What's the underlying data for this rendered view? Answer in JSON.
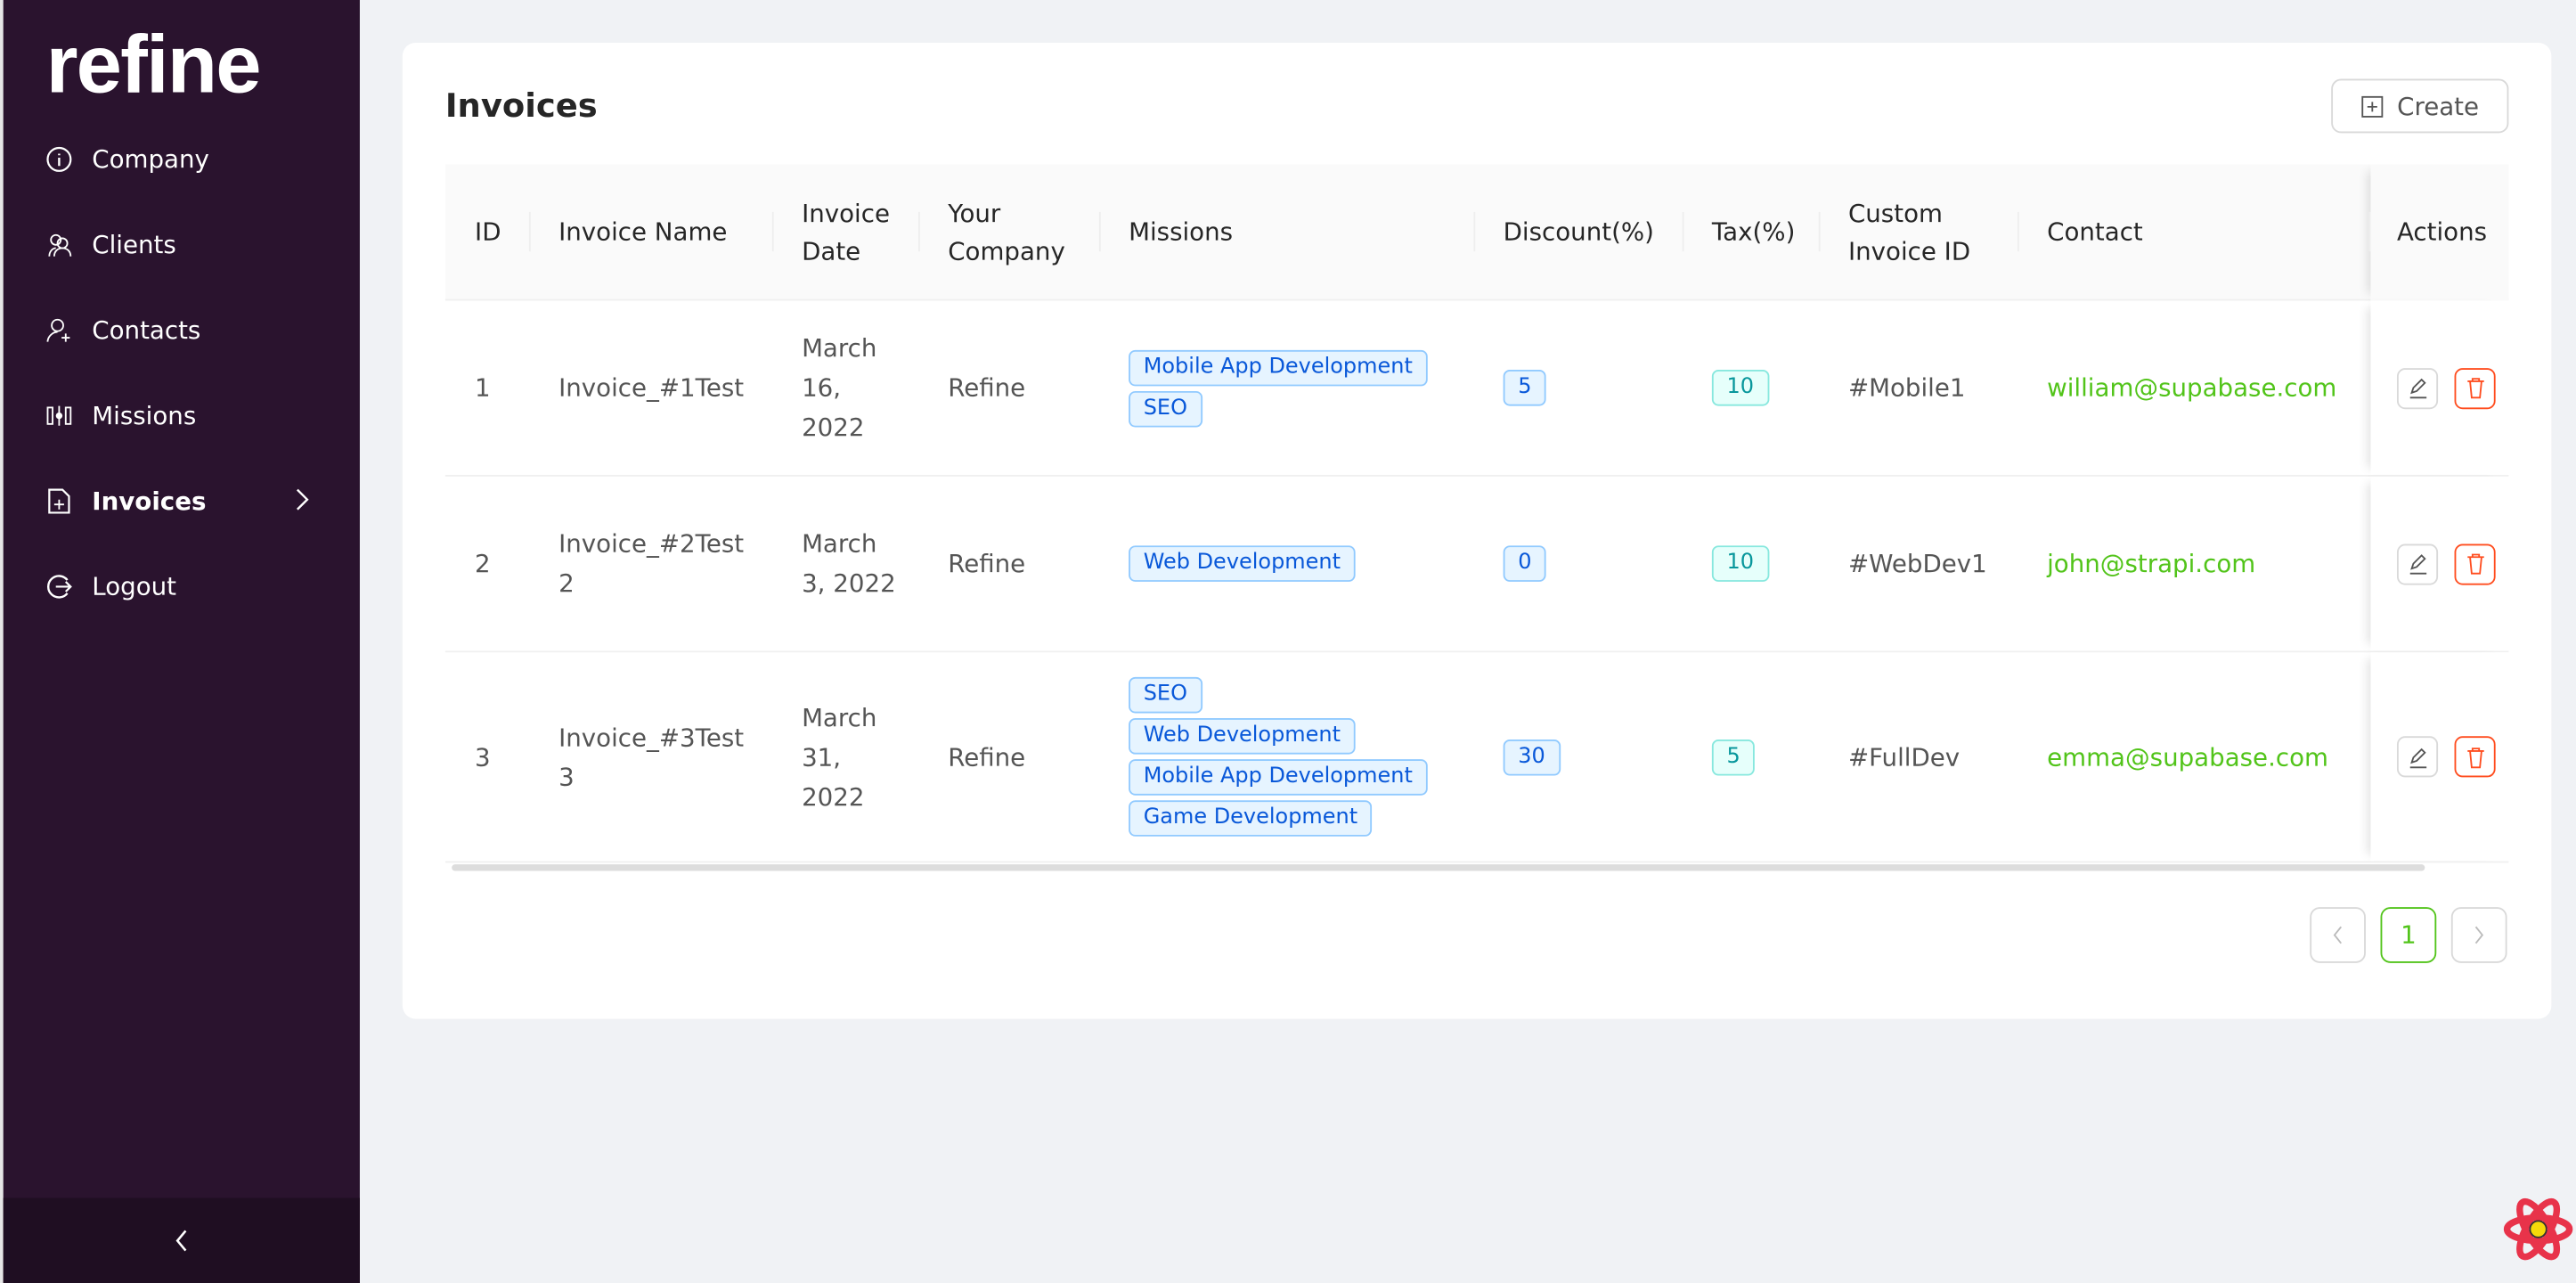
{
  "sidebar": {
    "logo": "refine",
    "items": [
      {
        "label": "Company",
        "icon": "info-circle-icon"
      },
      {
        "label": "Clients",
        "icon": "team-icon"
      },
      {
        "label": "Contacts",
        "icon": "user-add-icon"
      },
      {
        "label": "Missions",
        "icon": "sliders-icon"
      },
      {
        "label": "Invoices",
        "icon": "file-add-icon",
        "active": true
      },
      {
        "label": "Logout",
        "icon": "logout-icon"
      }
    ]
  },
  "page": {
    "title": "Invoices",
    "create_label": "Create"
  },
  "table": {
    "columns": [
      "ID",
      "Invoice Name",
      "Invoice Date",
      "Your Company",
      "Missions",
      "Discount(%)",
      "Tax(%)",
      "Custom Invoice ID",
      "Contact",
      "Actions"
    ],
    "rows": [
      {
        "id": "1",
        "name": "Invoice_#1Test",
        "date": "March 16, 2022",
        "company": "Refine",
        "missions": [
          "Mobile App Development",
          "SEO"
        ],
        "discount": "5",
        "tax": "10",
        "custom_id": "#Mobile1",
        "contact": "william@supabase.com"
      },
      {
        "id": "2",
        "name": "Invoice_#2Test 2",
        "date": "March 3, 2022",
        "company": "Refine",
        "missions": [
          "Web Development"
        ],
        "discount": "0",
        "tax": "10",
        "custom_id": "#WebDev1",
        "contact": "john@strapi.com"
      },
      {
        "id": "3",
        "name": "Invoice_#3Test 3",
        "date": "March 31, 2022",
        "company": "Refine",
        "missions": [
          "SEO",
          "Web Development",
          "Mobile App Development",
          "Game Development"
        ],
        "discount": "30",
        "tax": "5",
        "custom_id": "#FullDev",
        "contact": "emma@supabase.com"
      }
    ]
  },
  "pagination": {
    "current": "1"
  },
  "colors": {
    "sidebar": "#2a132e",
    "accent": "#52c41a",
    "danger": "#ff4d1f",
    "tag_blue": "#0958d9",
    "tag_cyan": "#08979c"
  }
}
